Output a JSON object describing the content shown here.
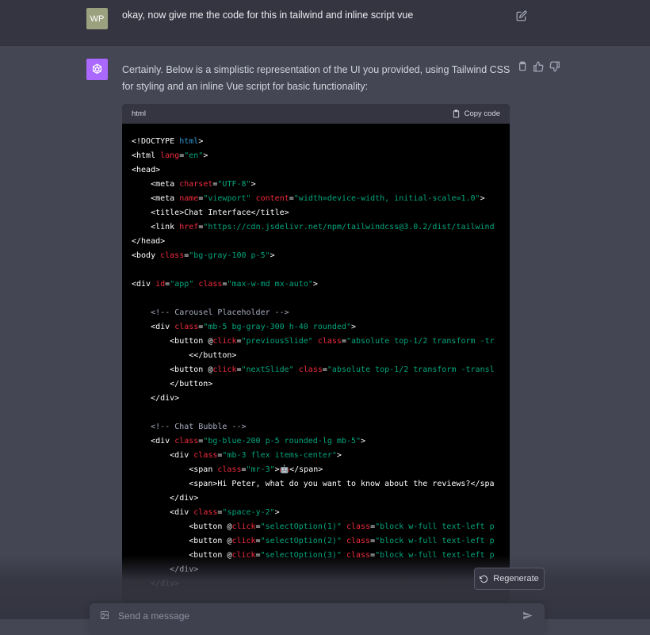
{
  "user_message": {
    "avatar_initials": "WP",
    "text": "okay, now give me the code for this in tailwind and inline script vue"
  },
  "assistant_message": {
    "text": "Certainly. Below is a simplistic representation of the UI you provided, using Tailwind CSS for styling and an inline Vue script for basic functionality:"
  },
  "code_block": {
    "language": "html",
    "copy_label": "Copy code"
  },
  "footer": {
    "regenerate_label": "Regenerate",
    "input_placeholder": "Send a message"
  },
  "colors": {
    "user_row_bg": "#343541",
    "assistant_row_bg": "#444654",
    "assistant_avatar": "#ab68ff",
    "user_avatar": "#9ba17e",
    "code_attr": "#f22c3d",
    "code_string": "#00a67d",
    "code_keyword": "#2e95d3"
  }
}
